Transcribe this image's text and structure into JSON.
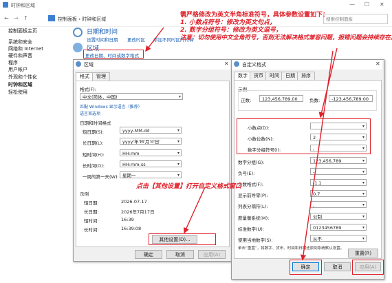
{
  "window": {
    "title": "时钟和区域",
    "controls": [
      "—",
      "☐",
      "✕"
    ]
  },
  "address": {
    "crumbs": "控制面板  ›  时钟和区域",
    "search_placeholder": "搜索控制面板"
  },
  "sidebar": {
    "items": [
      "控制面板主页",
      "系统和安全",
      "网络和 Internet",
      "硬件和声音",
      "程序",
      "用户帐户",
      "外观和个性化",
      "时钟和区域",
      "轻松使用"
    ]
  },
  "main": {
    "datetime": {
      "heading": "日期和时间",
      "links": [
        "设置时间和日期",
        "更改时区",
        "添加不同时区的时钟"
      ]
    },
    "region": {
      "heading": "区域",
      "link": "更改日期、时间或数字格式"
    }
  },
  "region_dialog": {
    "title": "区域",
    "tabs": [
      "格式",
      "管理"
    ],
    "format_label": "格式(F):",
    "format_value": "中文(简体，中国)",
    "lang_link1": "匹配 Windows 显示语言（推荐）",
    "lang_link2": "语言首选项",
    "section": "日期和时间格式",
    "rows": [
      {
        "label": "短日期(S):",
        "value": "yyyy-MM-dd"
      },
      {
        "label": "长日期(L):",
        "value": "yyyy'年'M'月'd'日'"
      },
      {
        "label": "短时间(H):",
        "value": "HH:mm"
      },
      {
        "label": "长时间(O):",
        "value": "HH:mm:ss"
      },
      {
        "label": "一周的第一天(W):",
        "value": "星期一"
      }
    ],
    "example_label": "示例",
    "examples": [
      {
        "label": "短日期:",
        "value": "2026-07-17"
      },
      {
        "label": "长日期:",
        "value": "2026年7月17日"
      },
      {
        "label": "短时间:",
        "value": "16:39"
      },
      {
        "label": "长时间:",
        "value": "16:39:08"
      }
    ],
    "other_settings": "其他设置(D)...",
    "buttons": [
      "确定",
      "取消",
      "应用(A)"
    ]
  },
  "custom_dialog": {
    "title": "自定义格式",
    "tabs": [
      "数字",
      "货币",
      "时间",
      "日期",
      "排序"
    ],
    "example_label": "示例",
    "positive_label": "正数:",
    "positive_value": "123,456,789.00",
    "negative_label": "负数:",
    "negative_value": "-123,456,789.00",
    "rows": [
      {
        "label": "小数点(D):",
        "value": ""
      },
      {
        "label": "小数位数(N):",
        "value": "2"
      },
      {
        "label": "数字分组符号(I):",
        "value": ","
      },
      {
        "label": "数字分组(G):",
        "value": "123,456,789"
      },
      {
        "label": "负号(E):",
        "value": "-"
      },
      {
        "label": "负数格式(F):",
        "value": "-1.1"
      },
      {
        "label": "显示前导零(P):",
        "value": "0.7"
      },
      {
        "label": "列表分隔符(L):",
        "value": ","
      },
      {
        "label": "度量衡系统(M):",
        "value": "公制"
      },
      {
        "label": "标准数字(U):",
        "value": "0123456789"
      },
      {
        "label": "使用当地数字(S):",
        "value": "从不"
      }
    ],
    "reset_hint": "单击“重置”，将数字、货币、时间和日期还原到系统默认设置。",
    "reset_button": "重置(R)",
    "buttons": [
      "确定",
      "取消",
      "应用(A)"
    ]
  },
  "annotations": {
    "top_note": [
      "需严格修改为英文半角标准符号，具体参数设置如下：",
      "1. 小数点符号：修改为英文句点，",
      "2. 数字分组符号：修改为英文逗号，",
      "注意：切勿使用中文全角符号，否则无法解决格式兼容问题，报错问题会持续存在。"
    ],
    "mid_note": "点击【其他设置】打开自定义格式窗口",
    "accent": "#e0202a"
  }
}
